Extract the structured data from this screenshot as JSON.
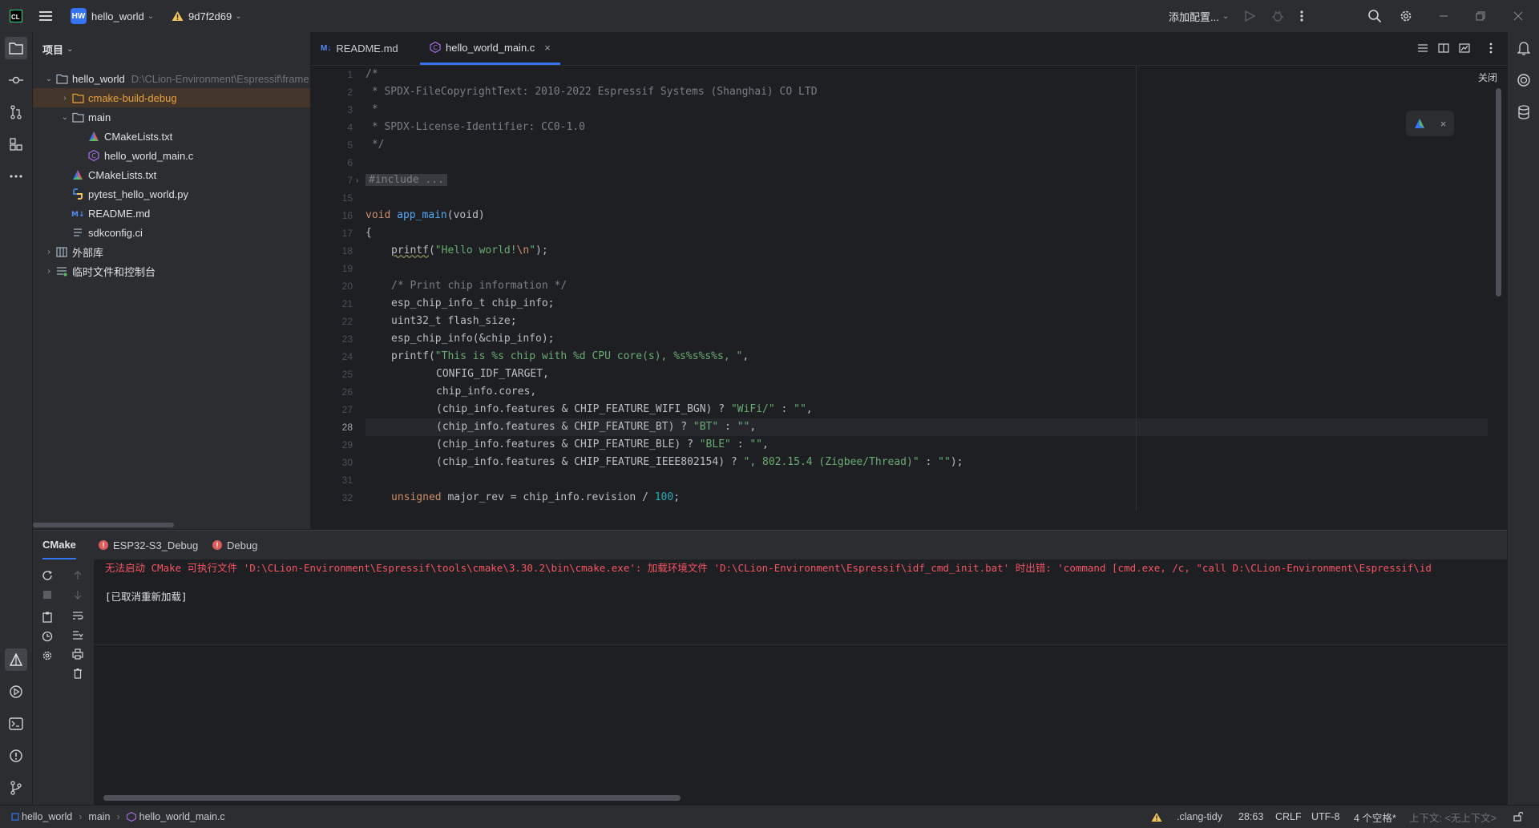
{
  "titlebar": {
    "app_icon_text": "CL",
    "project_badge": "HW",
    "project_name": "hello_world",
    "vcs_commit": "9d7f2d69",
    "run_config": "添加配置..."
  },
  "project_panel": {
    "header": "项目",
    "tree": [
      {
        "label": "hello_world",
        "path": "D:\\CLion-Environment\\Espressif\\frame",
        "icon": "folder-icon"
      },
      {
        "label": "cmake-build-debug",
        "icon": "folder-icon"
      },
      {
        "label": "main",
        "icon": "folder-icon"
      },
      {
        "label": "CMakeLists.txt",
        "icon": "cmake-icon"
      },
      {
        "label": "hello_world_main.c",
        "icon": "c-file-icon"
      },
      {
        "label": "CMakeLists.txt",
        "icon": "cmake-icon"
      },
      {
        "label": "pytest_hello_world.py",
        "icon": "python-icon"
      },
      {
        "label": "README.md",
        "icon": "markdown-icon"
      },
      {
        "label": "sdkconfig.ci",
        "icon": "text-file-icon"
      },
      {
        "label": "外部库",
        "icon": "library-icon"
      },
      {
        "label": "临时文件和控制台",
        "icon": "scratch-icon"
      }
    ]
  },
  "editor": {
    "tabs": [
      {
        "icon_text": "M↓",
        "label": "README.md"
      },
      {
        "label": "hello_world_main.c"
      }
    ],
    "close_hint": "关闭",
    "line_numbers": [
      "1",
      "2",
      "3",
      "4",
      "5",
      "6",
      "7",
      "15",
      "16",
      "17",
      "18",
      "19",
      "20",
      "21",
      "22",
      "23",
      "24",
      "25",
      "26",
      "27",
      "28",
      "29",
      "30",
      "31",
      "32"
    ],
    "current_line": "28",
    "code": {
      "l1": "/*",
      "l2": " * SPDX-FileCopyrightText: 2010-2022 Espressif Systems (Shanghai) CO LTD",
      "l3": " *",
      "l4": " * SPDX-License-Identifier: CC0-1.0",
      "l5": " */",
      "l7": "#include ...",
      "l16_kw": "void",
      "l16_fn": "app_main",
      "l16_rest": "(void)",
      "l17": "{",
      "l18_fn": "printf",
      "l18_open": "(",
      "l18_str1": "\"Hello world!",
      "l18_esc": "\\n",
      "l18_str2": "\"",
      "l18_close": ");",
      "l20": "/* Print chip information */",
      "l21": "esp_chip_info_t chip_info;",
      "l22": "uint32_t flash_size;",
      "l23": "esp_chip_info(&chip_info);",
      "l24_a": "printf(",
      "l24_str": "\"This is %s chip with %d CPU core(s), %s%s%s%s, \"",
      "l24_b": ",",
      "l25": "CONFIG_IDF_TARGET,",
      "l26": "chip_info.cores,",
      "l27_a": "(chip_info.features & CHIP_FEATURE_WIFI_BGN) ? ",
      "l27_s1": "\"WiFi/\"",
      "l27_b": " : ",
      "l27_s2": "\"\"",
      "l27_c": ",",
      "l28_a": "(chip_info.features & CHIP_FEATURE_BT) ? ",
      "l28_s1": "\"BT\"",
      "l28_b": " : ",
      "l28_s2": "\"\"",
      "l28_c": ",",
      "l29_a": "(chip_info.features & CHIP_FEATURE_BLE) ? ",
      "l29_s1": "\"BLE\"",
      "l29_b": " : ",
      "l29_s2": "\"\"",
      "l29_c": ",",
      "l30_a": "(chip_info.features & CHIP_FEATURE_IEEE802154) ? ",
      "l30_s1": "\", 802.15.4 (Zigbee/Thread)\"",
      "l30_b": " : ",
      "l30_s2": "\"\"",
      "l30_c": ");",
      "l32_kw": "unsigned",
      "l32_a": " major_rev = chip_info.revision / ",
      "l32_num": "100",
      "l32_b": ";"
    }
  },
  "bottom_panel": {
    "tabs": [
      "CMake",
      "ESP32-S3_Debug",
      "Debug"
    ],
    "error_line": "无法启动 CMake 可执行文件 'D:\\CLion-Environment\\Espressif\\tools\\cmake\\3.30.2\\bin\\cmake.exe': 加载环境文件 'D:\\CLion-Environment\\Espressif\\idf_cmd_init.bat' 时出错: 'command [cmd.exe, /c, \"call D:\\CLion-Environment\\Espressif\\id",
    "info_line": "[已取消重新加载]"
  },
  "statusbar": {
    "breadcrumb": [
      "hello_world",
      "main",
      "hello_world_main.c"
    ],
    "inspector": ".clang-tidy",
    "position": "28:63",
    "line_ending": "CRLF",
    "encoding": "UTF-8",
    "indent": "4 个空格*",
    "context": "上下文: <无上下文>"
  },
  "colors": {
    "accent": "#3574f0",
    "error": "#f75464",
    "warning": "#f2c55c",
    "background": "#1e1f22",
    "panel": "#2b2d30"
  }
}
